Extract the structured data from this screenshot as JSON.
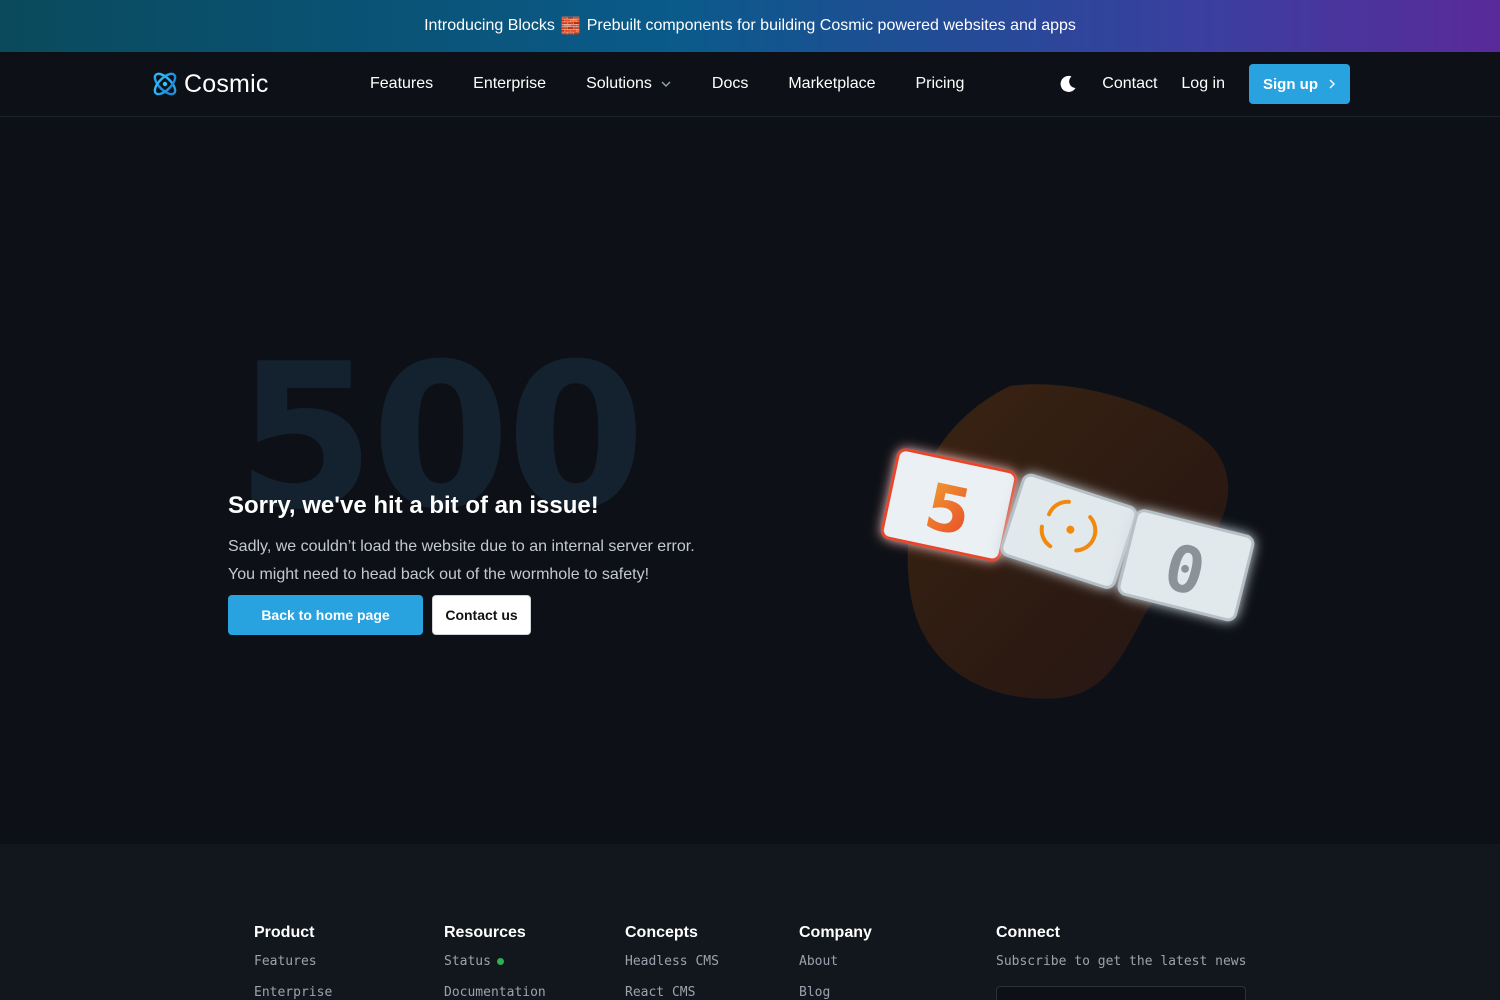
{
  "announcement": {
    "text_before": "Introducing Blocks",
    "brick_glyph": "🧱",
    "text_after": "Prebuilt components for building Cosmic powered websites and apps"
  },
  "nav": {
    "logo_text": "Cosmic",
    "links": [
      {
        "label": "Features"
      },
      {
        "label": "Enterprise"
      },
      {
        "label": "Solutions",
        "has_dropdown": true
      },
      {
        "label": "Docs"
      },
      {
        "label": "Marketplace"
      },
      {
        "label": "Pricing"
      }
    ],
    "theme_icon": "moon-icon",
    "contact": "Contact",
    "login": "Log in",
    "signup": "Sign up"
  },
  "hero": {
    "big_code": "500",
    "title": "Sorry, we've hit a bit of an issue!",
    "line1": "Sadly, we couldn’t load the website due to an internal server error.",
    "line2": "You might need to head back out of the wormhole to safety!",
    "primary_button": "Back to home page",
    "secondary_button": "Contact us",
    "tiles": [
      "5",
      "0"
    ]
  },
  "footer": {
    "columns": [
      {
        "title": "Product",
        "items": [
          "Features",
          "Enterprise"
        ]
      },
      {
        "title": "Resources",
        "items": [
          "Status",
          "Documentation"
        ]
      },
      {
        "title": "Concepts",
        "items": [
          "Headless CMS",
          "React CMS"
        ]
      },
      {
        "title": "Company",
        "items": [
          "About",
          "Blog"
        ]
      },
      {
        "title": "Connect",
        "subtitle": "Subscribe to get the latest news"
      }
    ]
  },
  "colors": {
    "accent": "#29a3e0",
    "background": "#0d1117",
    "footer_bg": "#12171d",
    "status_green": "#2bb24c"
  }
}
